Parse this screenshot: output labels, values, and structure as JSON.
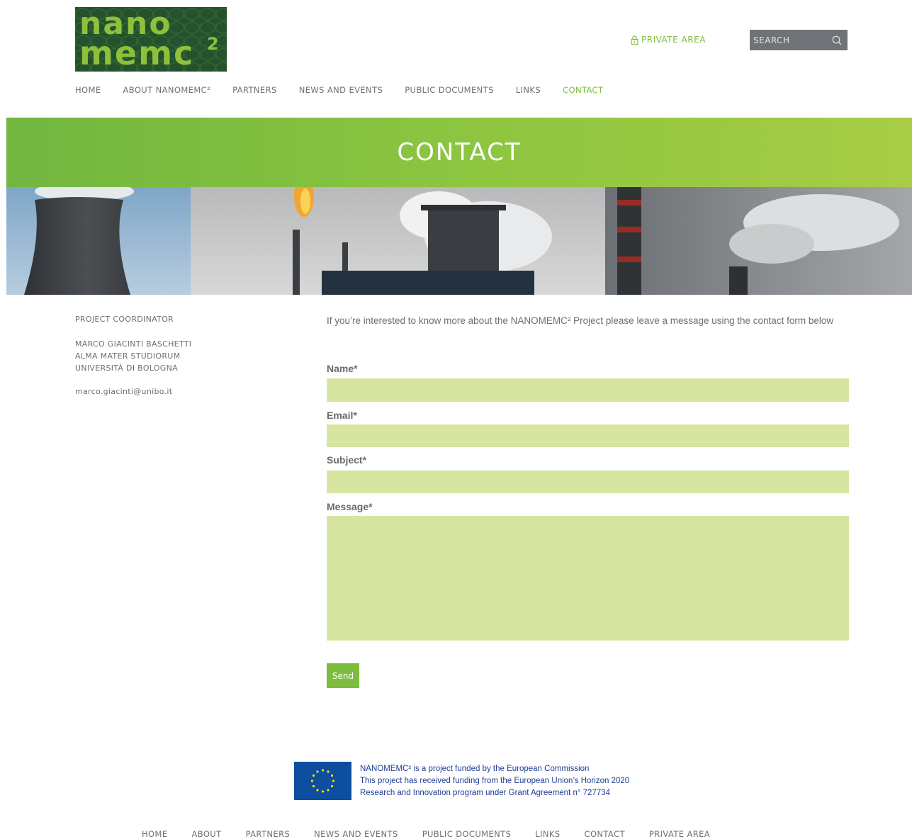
{
  "header": {
    "logo": {
      "line1": "nano",
      "line2": "memc",
      "sup": "2"
    },
    "private_area": {
      "label": "PRIVATE AREA",
      "icon": "lock-icon"
    },
    "search": {
      "placeholder": "SEARCH",
      "icon": "search-icon"
    }
  },
  "nav": {
    "items": [
      {
        "label": "HOME"
      },
      {
        "label": "ABOUT NANOMEMC²"
      },
      {
        "label": "PARTNERS"
      },
      {
        "label": "NEWS AND EVENTS"
      },
      {
        "label": "PUBLIC DOCUMENTS"
      },
      {
        "label": "LINKS"
      },
      {
        "label": "CONTACT",
        "active": true
      }
    ]
  },
  "banner": {
    "title": "CONTACT"
  },
  "sidebar": {
    "role": "PROJECT COORDINATOR",
    "person": {
      "name": "MARCO GIACINTI BASCHETTI",
      "org1": "ALMA MATER STUDIORUM",
      "org2": "UNIVERSITÀ DI BOLOGNA"
    },
    "email": "marco.giacinti@unibo.it"
  },
  "contact_form": {
    "intro": "If you’re interested to know more about the NANOMEMC² Project please leave a message using the contact form below",
    "fields": {
      "name": {
        "label": "Name*",
        "value": ""
      },
      "email": {
        "label": "Email*",
        "value": ""
      },
      "subject": {
        "label": "Subject*",
        "value": ""
      },
      "message": {
        "label": "Message*",
        "value": ""
      }
    },
    "send_label": "Send"
  },
  "footer": {
    "funding": {
      "line1": "NANOMEMC² is a project funded by the European Commission",
      "line2": "This project has received funding from the European Union’s Horizon 2020",
      "line3": "Research and Innovation program under Grant Agreement n° 727734"
    },
    "nav": [
      {
        "label": "HOME"
      },
      {
        "label": "ABOUT"
      },
      {
        "label": "PARTNERS"
      },
      {
        "label": "NEWS AND EVENTS"
      },
      {
        "label": "PUBLIC DOCUMENTS"
      },
      {
        "label": "LINKS"
      },
      {
        "label": "CONTACT"
      },
      {
        "label": "PRIVATE AREA"
      }
    ]
  },
  "colors": {
    "accent": "#7dbd3e",
    "field_bg": "#d6e6a1",
    "search_bg": "#6f7277",
    "eu_blue": "#0d4ea1"
  }
}
